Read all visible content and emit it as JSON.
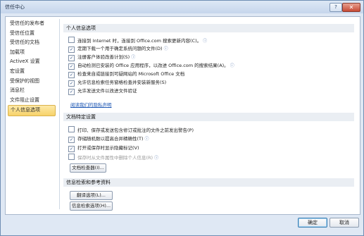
{
  "window": {
    "title": "信任中心",
    "help_glyph": "?",
    "close_glyph": "✕"
  },
  "sidebar": {
    "items": [
      {
        "label": "受信任的发布者"
      },
      {
        "label": "受信任位置"
      },
      {
        "label": "受信任的文档"
      },
      {
        "label": "加载项"
      },
      {
        "label": "ActiveX 设置"
      },
      {
        "label": "宏设置"
      },
      {
        "label": "受保护的视图"
      },
      {
        "label": "消息栏"
      },
      {
        "label": "文件阻止设置"
      },
      {
        "label": "个人信息选项"
      }
    ],
    "selected_index": 9
  },
  "personal": {
    "header": "个人信息选项",
    "options": [
      {
        "label": "连接到 Internet 时，连接到 Office.com 搜索更新内容(C)。",
        "checked": false
      },
      {
        "label": "定期下载一个用于确定系统问题的文件(D)",
        "checked": true
      },
      {
        "label": "注册客户体验改善计划(S)",
        "checked": true
      },
      {
        "label": "自动检测已安装的 Office 应用程序，以改进 Office.com 的搜索结果(A)。",
        "checked": true
      },
      {
        "label": "检查来自或链接到可疑网站的 Microsoft Office 文档",
        "checked": true
      },
      {
        "label": "允许信息检索任务窗格检查并安装新服务(S)",
        "checked": true
      },
      {
        "label": "允许发送文件以改进文件验证",
        "checked": true
      }
    ],
    "privacy_link": "阅读我们的隐私声明"
  },
  "doc": {
    "header": "文档特定设置",
    "options": [
      {
        "label": "打印、保存或发送包含修订或批注的文件之前发出警告(P)",
        "checked": false,
        "disabled": false
      },
      {
        "label": "存储随机数以提高合并精确性(T)",
        "checked": true,
        "disabled": false
      },
      {
        "label": "打开或保存时显示隐藏标记(V)",
        "checked": true,
        "disabled": false
      },
      {
        "label": "保存时从文件属性中删除个人信息(R)",
        "checked": false,
        "disabled": true
      }
    ],
    "inspector_button": "文档检查器(I)..."
  },
  "research": {
    "header": "信息检索和参考资料",
    "translate_button": "翻译选项(L)...",
    "research_button": "信息检索选项(H)..."
  },
  "footer": {
    "ok": "确定",
    "cancel": "取消"
  },
  "check_glyph": "✓",
  "info_glyph": "ⓘ"
}
